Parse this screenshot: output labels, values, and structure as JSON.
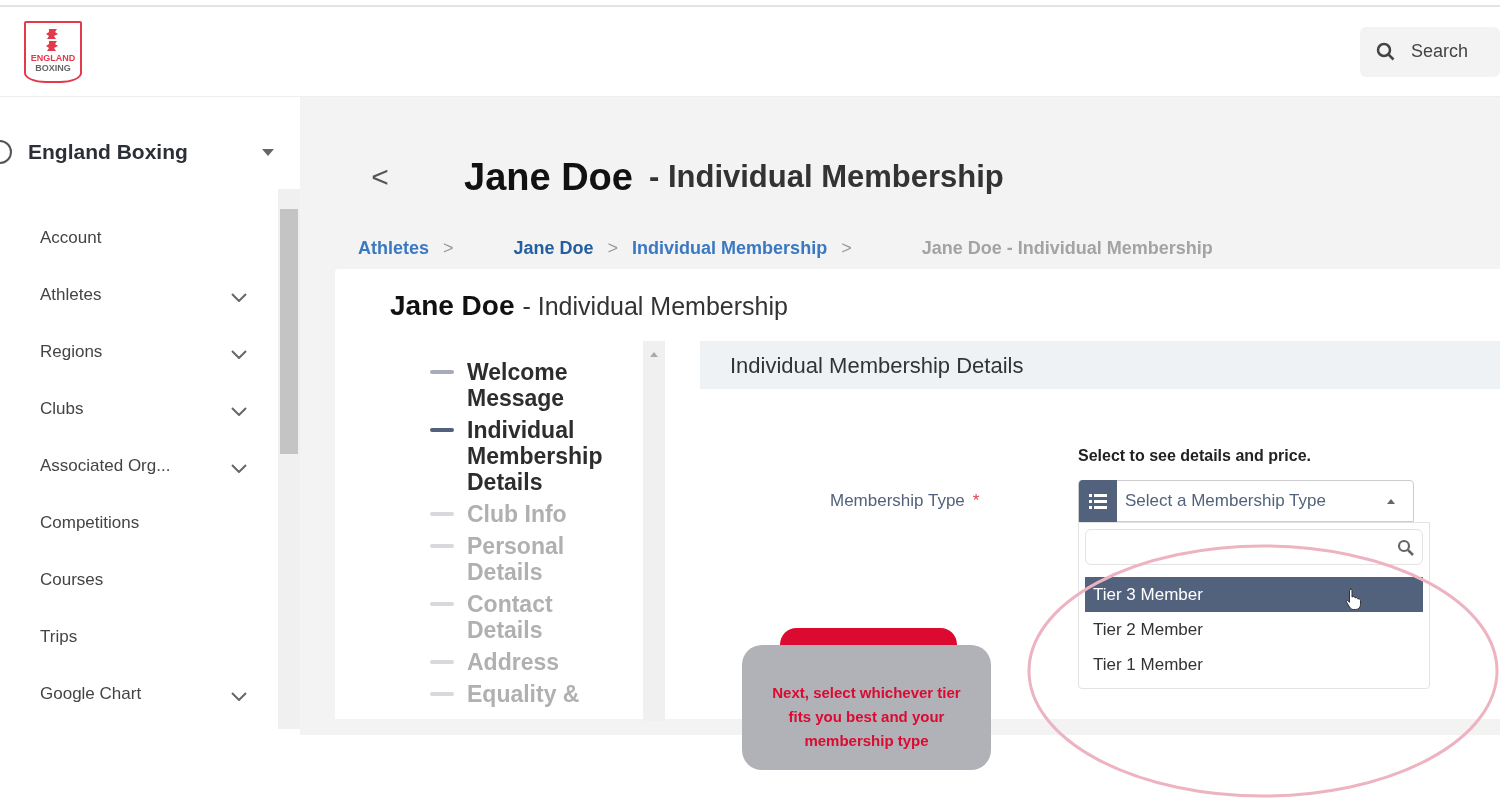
{
  "header": {
    "logo_text": [
      "ENGLAND",
      "BOXING"
    ],
    "search": {
      "label": "Search"
    }
  },
  "sidebar": {
    "org": "England Boxing",
    "items": [
      {
        "label": "Account",
        "expandable": false
      },
      {
        "label": "Athletes",
        "expandable": true
      },
      {
        "label": "Regions",
        "expandable": true
      },
      {
        "label": "Clubs",
        "expandable": true
      },
      {
        "label": "Associated Org...",
        "expandable": true
      },
      {
        "label": "Competitions",
        "expandable": false
      },
      {
        "label": "Courses",
        "expandable": false
      },
      {
        "label": "Trips",
        "expandable": false
      },
      {
        "label": "Google Chart",
        "expandable": true
      }
    ]
  },
  "page": {
    "back": "<",
    "title_name": "Jane Doe",
    "title_rest": "- Individual Membership",
    "breadcrumbs": [
      {
        "label": "Athletes",
        "kind": "link"
      },
      {
        "label": "Jane Doe",
        "kind": "link"
      },
      {
        "label": "Individual Membership",
        "kind": "link"
      },
      {
        "label": "Jane Doe - Individual Membership",
        "kind": "current"
      }
    ],
    "separator": ">"
  },
  "card": {
    "title_name": "Jane Doe",
    "title_rest": "- Individual Membership",
    "steps": [
      {
        "label": "Welcome Message",
        "selected": false
      },
      {
        "label": "Individual Membership Details",
        "selected": true
      },
      {
        "label": "Club Info",
        "selected": false
      },
      {
        "label": "Personal Details",
        "selected": false
      },
      {
        "label": "Contact Details",
        "selected": false
      },
      {
        "label": "Address",
        "selected": false
      },
      {
        "label": "Equality &",
        "selected": false
      }
    ],
    "section_title": "Individual Membership Details",
    "hint": "Select to see details and price.",
    "field_label": "Membership Type",
    "required_mark": "*",
    "select": {
      "placeholder": "Select a Membership Type",
      "expanded": true,
      "options": [
        {
          "label": "Tier 3 Member",
          "selected": true
        },
        {
          "label": "Tier 2 Member",
          "selected": false
        },
        {
          "label": "Tier 1 Member",
          "selected": false
        }
      ]
    }
  },
  "callout": {
    "text": "Next, select whichever tier fits you best and your membership type"
  }
}
